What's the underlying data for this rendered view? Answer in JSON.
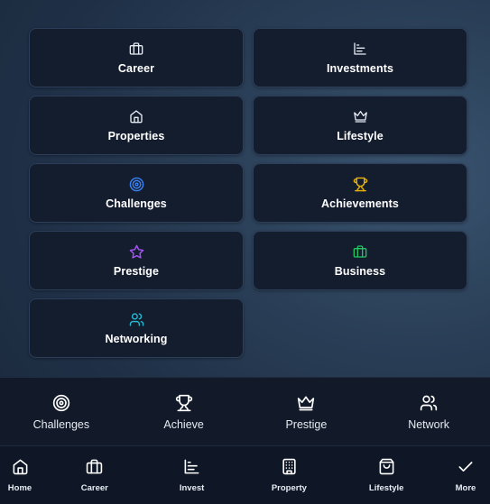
{
  "tiles": [
    {
      "label": "Career",
      "icon": "briefcase-icon",
      "color": "#e8edf4"
    },
    {
      "label": "Investments",
      "icon": "bar-chart-icon",
      "color": "#e8edf4"
    },
    {
      "label": "Properties",
      "icon": "home-icon",
      "color": "#e8edf4"
    },
    {
      "label": "Lifestyle",
      "icon": "crown-icon",
      "color": "#e8edf4"
    },
    {
      "label": "Challenges",
      "icon": "target-icon",
      "color": "#3b82f6"
    },
    {
      "label": "Achievements",
      "icon": "trophy-icon",
      "color": "#eab308"
    },
    {
      "label": "Prestige",
      "icon": "star-icon",
      "color": "#a855f7"
    },
    {
      "label": "Business",
      "icon": "briefcase-icon",
      "color": "#22c55e"
    },
    {
      "label": "Networking",
      "icon": "users-icon",
      "color": "#22b8cf"
    }
  ],
  "quickbar": [
    {
      "label": "Challenges",
      "icon": "target-icon"
    },
    {
      "label": "Achieve",
      "icon": "trophy-icon"
    },
    {
      "label": "Prestige",
      "icon": "crown-icon"
    },
    {
      "label": "Network",
      "icon": "users-icon"
    }
  ],
  "navbar": [
    {
      "label": "Home",
      "icon": "home-icon"
    },
    {
      "label": "Career",
      "icon": "briefcase-icon"
    },
    {
      "label": "Invest",
      "icon": "bar-chart-icon"
    },
    {
      "label": "Property",
      "icon": "building-icon"
    },
    {
      "label": "Lifestyle",
      "icon": "shopping-bag-icon"
    },
    {
      "label": "More",
      "icon": "check-icon"
    }
  ]
}
